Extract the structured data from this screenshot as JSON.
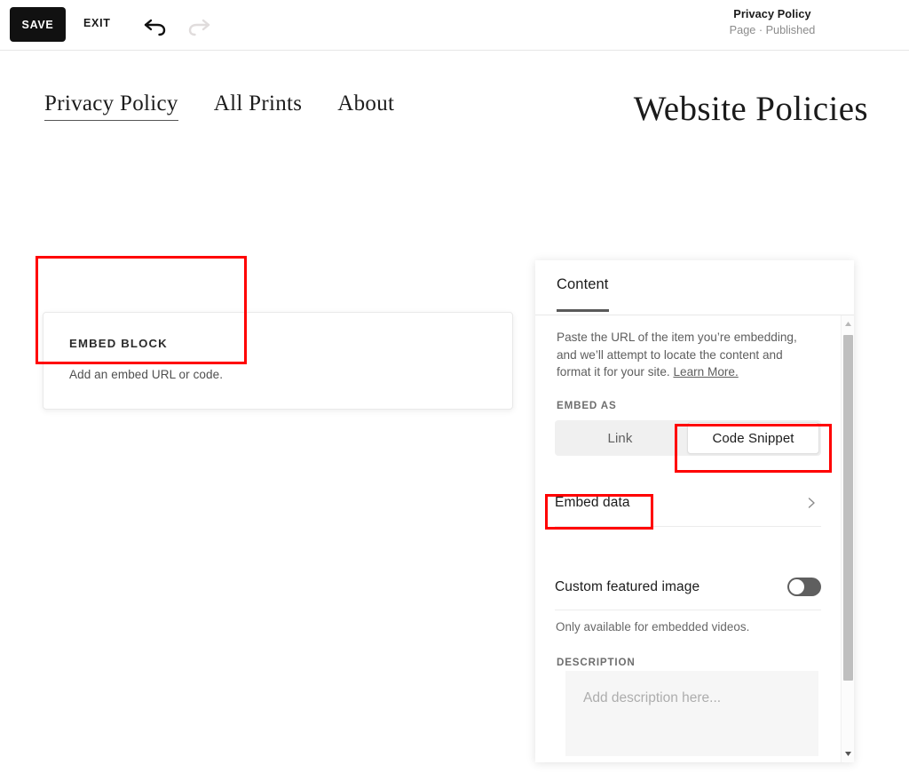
{
  "toolbar": {
    "save_label": "SAVE",
    "exit_label": "EXIT",
    "undo_icon": "undo-arrow-icon",
    "redo_icon": "redo-arrow-icon",
    "page_title": "Privacy Policy",
    "page_status": "Page · Published"
  },
  "site": {
    "logo": "Website Policies",
    "nav": [
      {
        "label": "Privacy Policy",
        "active": true
      },
      {
        "label": "All Prints",
        "active": false
      },
      {
        "label": "About",
        "active": false
      }
    ]
  },
  "canvas": {
    "embed_block": {
      "title": "EMBED BLOCK",
      "subtitle": "Add an embed URL or code."
    }
  },
  "panel": {
    "tabs": [
      {
        "label": "Content",
        "active": true
      }
    ],
    "help_text": "Paste the URL of the item you’re embedding, and we’ll attempt to locate the content and format it for your site. ",
    "help_link": "Learn More.",
    "embed_as": {
      "label": "EMBED AS",
      "options": [
        {
          "label": "Link",
          "selected": false
        },
        {
          "label": "Code Snippet",
          "selected": true
        }
      ]
    },
    "embed_data": {
      "label": "Embed data",
      "chevron_icon": "chevron-right-icon"
    },
    "custom_featured_image": {
      "label": "Custom featured image",
      "enabled": false,
      "note": "Only available for embedded videos."
    },
    "description": {
      "label": "DESCRIPTION",
      "placeholder": "Add description here...",
      "value": ""
    },
    "scrollbar": {
      "up_icon": "scroll-up-arrow-icon",
      "down_icon": "scroll-down-arrow-icon"
    }
  },
  "annotations": {
    "accent_color": "#ff0000",
    "boxes": [
      {
        "target": "embed-block-card"
      },
      {
        "target": "code-snippet-segment"
      },
      {
        "target": "embed-data-row"
      }
    ]
  }
}
